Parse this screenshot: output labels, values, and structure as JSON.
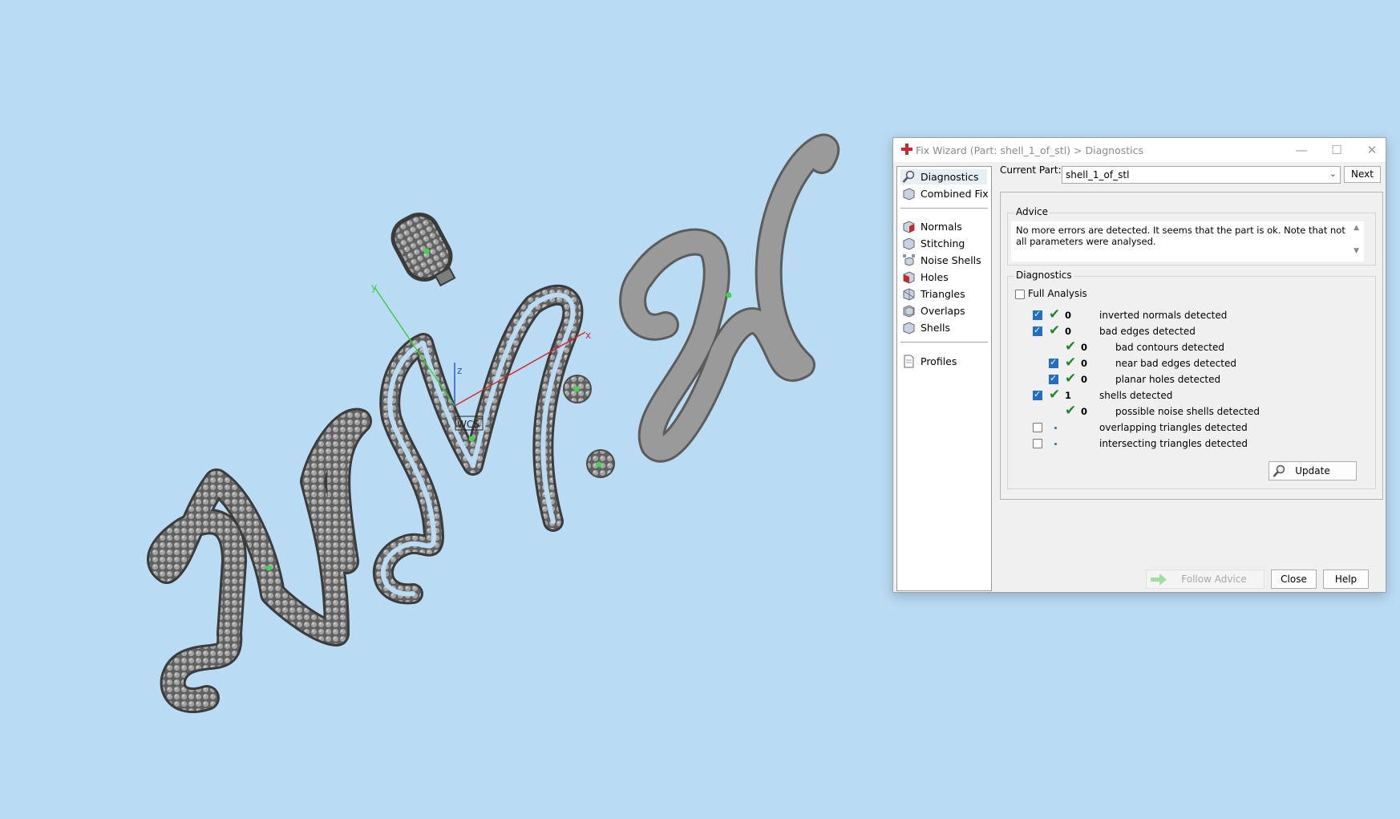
{
  "viewport": {
    "axis_labels": {
      "x": "x",
      "y": "y",
      "z": "z"
    },
    "wcs_label": "WCS"
  },
  "dialog": {
    "title": "Fix Wizard (Part: shell_1_of_stl) > Diagnostics",
    "window_controls": {
      "minimize": "—",
      "maximize": "☐",
      "close": "✕"
    },
    "nav": {
      "items": [
        "Diagnostics",
        "Combined Fix"
      ],
      "tools": [
        "Normals",
        "Stitching",
        "Noise Shells",
        "Holes",
        "Triangles",
        "Overlaps",
        "Shells"
      ],
      "extra": [
        "Profiles"
      ],
      "selected": "Diagnostics"
    },
    "current_part_label": "Current Part:",
    "current_part_value": "shell_1_of_stl",
    "next_label": "Next",
    "advice": {
      "title": "Advice",
      "text": "No more errors are detected. It seems that the part is ok. Note that not all parameters were analysed."
    },
    "diagnostics": {
      "title": "Diagnostics",
      "full_analysis_label": "Full Analysis",
      "full_analysis_checked": false,
      "rows": [
        {
          "checked": true,
          "status": "ok",
          "count": "0",
          "text": "inverted normals detected",
          "indent": 0
        },
        {
          "checked": true,
          "status": "ok",
          "count": "0",
          "text": "bad edges detected",
          "indent": 0
        },
        {
          "checked": null,
          "status": "ok",
          "count": "0",
          "text": "bad contours detected",
          "indent": 1
        },
        {
          "checked": true,
          "status": "ok",
          "count": "0",
          "text": "near bad edges detected",
          "indent": 1
        },
        {
          "checked": true,
          "status": "ok",
          "count": "0",
          "text": "planar holes detected",
          "indent": 1
        },
        {
          "checked": true,
          "status": "ok",
          "count": "1",
          "text": "shells detected",
          "indent": 0
        },
        {
          "checked": null,
          "status": "ok",
          "count": "0",
          "text": "possible noise shells detected",
          "indent": 1
        },
        {
          "checked": false,
          "status": "pending",
          "count": "",
          "text": "overlapping triangles detected",
          "indent": 0
        },
        {
          "checked": false,
          "status": "pending",
          "count": "",
          "text": "intersecting triangles detected",
          "indent": 0
        }
      ],
      "update_label": "Update"
    },
    "buttons": {
      "follow_advice": "Follow Advice",
      "close": "Close",
      "help": "Help"
    }
  },
  "colors": {
    "background": "#b9dcf4",
    "accent": "#1f6fc4",
    "ok": "#1a8a2a"
  }
}
